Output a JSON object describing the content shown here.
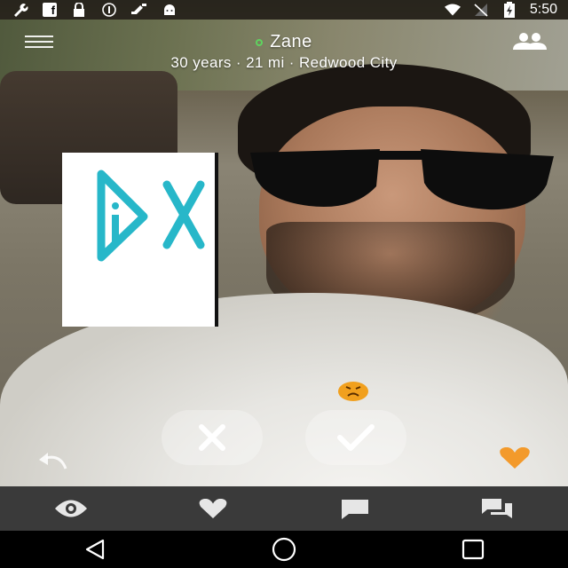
{
  "status_bar": {
    "time": "5:50",
    "left_icons": [
      "wrench-icon",
      "facebook-icon",
      "lock-icon",
      "info-circle-icon",
      "satellite-icon",
      "android-icon"
    ],
    "right_icons": [
      "wifi-icon",
      "no-signal-icon",
      "battery-charging-icon"
    ]
  },
  "header": {
    "menu_icon": "hamburger-menu-icon",
    "name": "Zane",
    "online": true,
    "details": "30 years · 21 mi · Redwood City",
    "people_icon": "people-icon"
  },
  "actions": {
    "reaction_icon": "frown-emoji-icon",
    "pass_icon": "close-icon",
    "like_icon": "checkmark-icon",
    "undo_icon": "undo-icon",
    "favorite_icon": "heart-icon"
  },
  "tabs": [
    {
      "icon": "eye-icon"
    },
    {
      "icon": "heart-icon"
    },
    {
      "icon": "chat-bubble-icon"
    },
    {
      "icon": "chat-bubbles-icon"
    }
  ],
  "nav": [
    "back-icon",
    "home-icon",
    "recents-icon"
  ],
  "colors": {
    "online": "#5fd35f",
    "favorite": "#f39a2b",
    "tab_bar": "#3a3a3a",
    "logo_cyan": "#27b7c9"
  }
}
